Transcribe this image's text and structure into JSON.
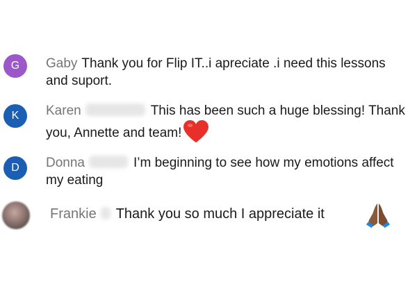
{
  "comments": [
    {
      "avatar_letter": "G",
      "avatar_color": "#9c58c9",
      "author": "Gaby",
      "text": "Thank you for Flip IT..i apreciate .i need this lessons and suport."
    },
    {
      "avatar_letter": "K",
      "avatar_color": "#1a5fb4",
      "author": "Karen",
      "text": "This has been such a huge blessing! Thank you, Annette and team!",
      "emoji": "heart-emoji"
    },
    {
      "avatar_letter": "D",
      "avatar_color": "#1a5fb4",
      "author": "Donna",
      "text": "I’m beginning to see how my emotions affect my eating"
    },
    {
      "avatar_type": "photo",
      "author": "Frankie",
      "text": "Thank you so much I appreciate it",
      "emoji": "folded-hands-emoji"
    }
  ]
}
